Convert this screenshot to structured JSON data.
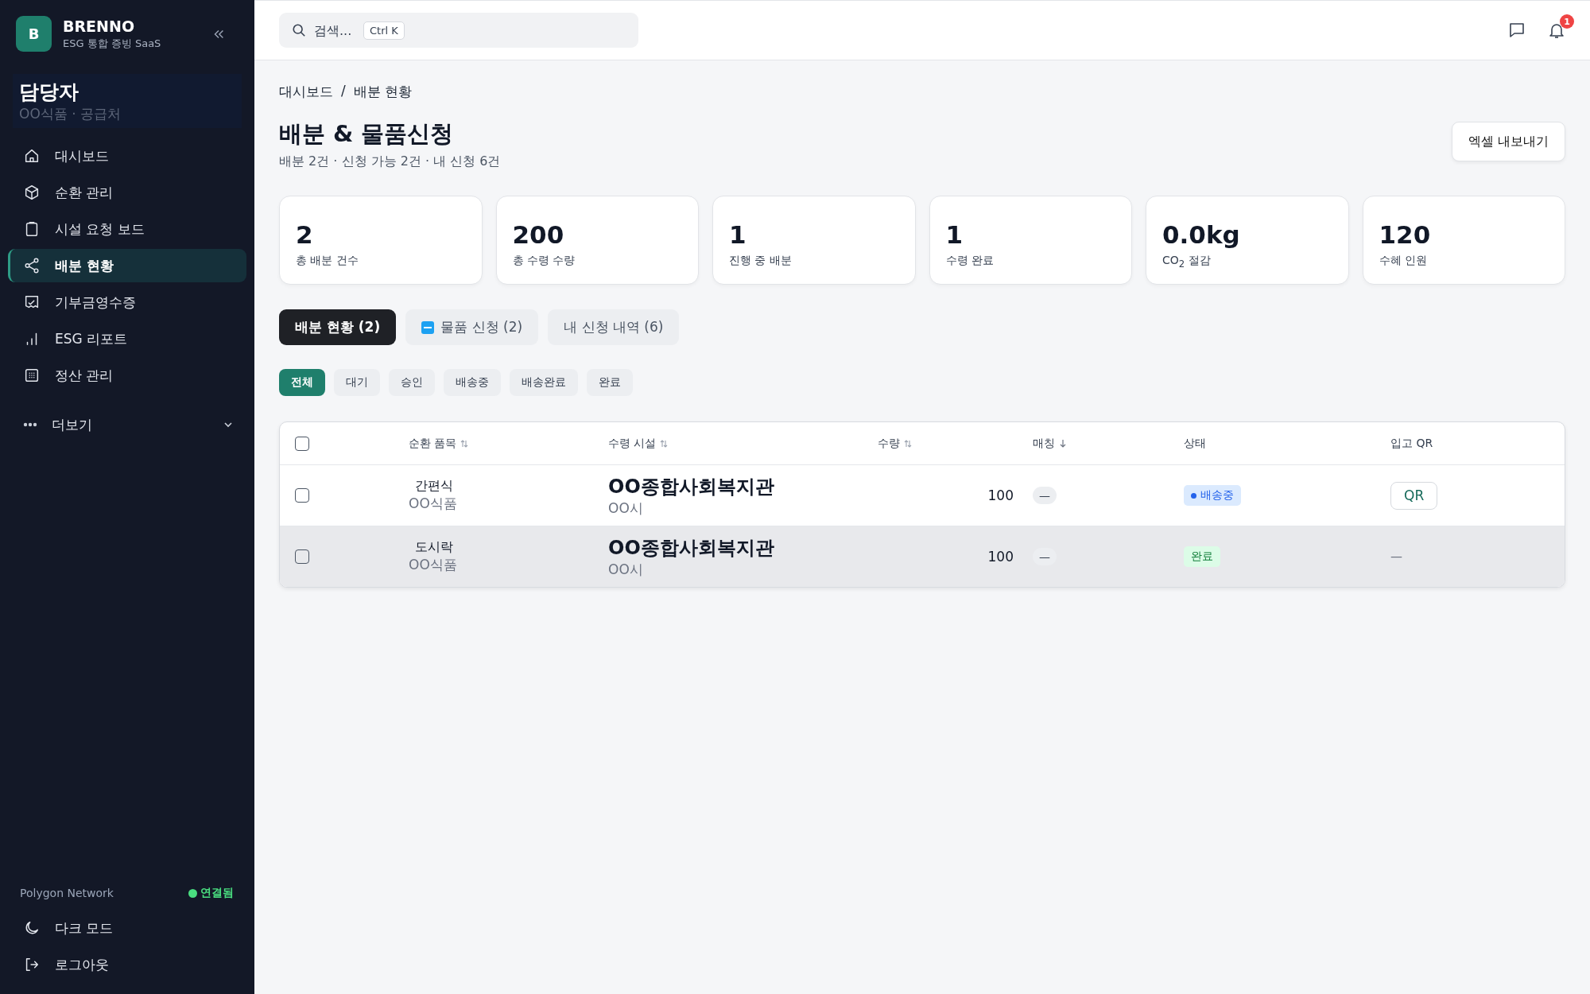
{
  "sidebar": {
    "brand": {
      "logo_letter": "B",
      "name": "BRENNO",
      "tagline": "ESG 통합 증빙 SaaS"
    },
    "user": {
      "role": "담당자",
      "org": "OO식품 · 공급처"
    },
    "items": [
      {
        "label": "대시보드",
        "selected": false
      },
      {
        "label": "순환 관리",
        "selected": false
      },
      {
        "label": "시설 요청 보드",
        "selected": false
      },
      {
        "label": "배분 현황",
        "selected": true
      },
      {
        "label": "기부금영수증",
        "selected": false
      },
      {
        "label": "ESG 리포트",
        "selected": false
      },
      {
        "label": "정산 관리",
        "selected": false
      }
    ],
    "more": {
      "label": "더보기",
      "expanded": false
    },
    "network": {
      "name": "Polygon Network",
      "status": "연결됨",
      "color": "#4ade80"
    },
    "footer_items": [
      {
        "label": "다크 모드"
      },
      {
        "label": "로그아웃"
      }
    ]
  },
  "topbar": {
    "search": {
      "placeholder": "검색...",
      "shortcut": "Ctrl K"
    },
    "notification_count": "1"
  },
  "breadcrumb": [
    "대시보드",
    "배분 현황"
  ],
  "breadcrumb_separator": "/",
  "title": "배분 & 물품신청",
  "subtitle": "배분 2건 · 신청 가능 2건 · 내 신청 6건",
  "export_button": "엑셀 내보내기",
  "stats": [
    {
      "value": "2",
      "label": "총 배분 건수"
    },
    {
      "value": "200",
      "label": "총 수령 수량"
    },
    {
      "value": "1",
      "label": "진행 중 배분"
    },
    {
      "value": "1",
      "label": "수령 완료"
    },
    {
      "value": "0.0kg",
      "label": "CO$_{2}$ 절감"
    },
    {
      "value": "120",
      "label": "수혜 인원"
    }
  ],
  "tabs": [
    {
      "label": "배분 현황 (2)",
      "selected": true,
      "badge": false
    },
    {
      "label": "물품 신청 (2)",
      "selected": false,
      "badge": true
    },
    {
      "label": "내 신청 내역 (6)",
      "selected": false,
      "badge": false
    }
  ],
  "filters": [
    {
      "label": "전체",
      "selected": true
    },
    {
      "label": "대기",
      "selected": false
    },
    {
      "label": "승인",
      "selected": false
    },
    {
      "label": "배송중",
      "selected": false
    },
    {
      "label": "배송완료",
      "selected": false
    },
    {
      "label": "완료",
      "selected": false
    }
  ],
  "table": {
    "columns": [
      {
        "label": "순환 품목",
        "kind": "sortable"
      },
      {
        "label": "수령 시설",
        "kind": "sortable"
      },
      {
        "label": "수량",
        "kind": "sortable"
      },
      {
        "label": "매칭",
        "kind": "sorted"
      },
      {
        "label": "상태",
        "kind": "plain"
      },
      {
        "label": "입고 QR",
        "kind": "plain"
      }
    ],
    "select_all": false,
    "rows": [
      {
        "checked": false,
        "hovered": false,
        "item": "간편식",
        "supplier": "OO식품",
        "facility": "OO종합사회복지관",
        "city": "OO시",
        "quantity": "100",
        "matching": "—",
        "status": {
          "label": "배송중",
          "kind": "shipping",
          "color": "#2563eb"
        },
        "qr": {
          "kind": "button",
          "label": "QR"
        }
      },
      {
        "checked": false,
        "hovered": true,
        "item": "도시락",
        "supplier": "OO식품",
        "facility": "OO종합사회복지관",
        "city": "OO시",
        "quantity": "100",
        "matching": "—",
        "status": {
          "label": "완료",
          "kind": "done",
          "color": "#15803d"
        },
        "qr": {
          "kind": "text",
          "label": "—"
        }
      }
    ]
  }
}
